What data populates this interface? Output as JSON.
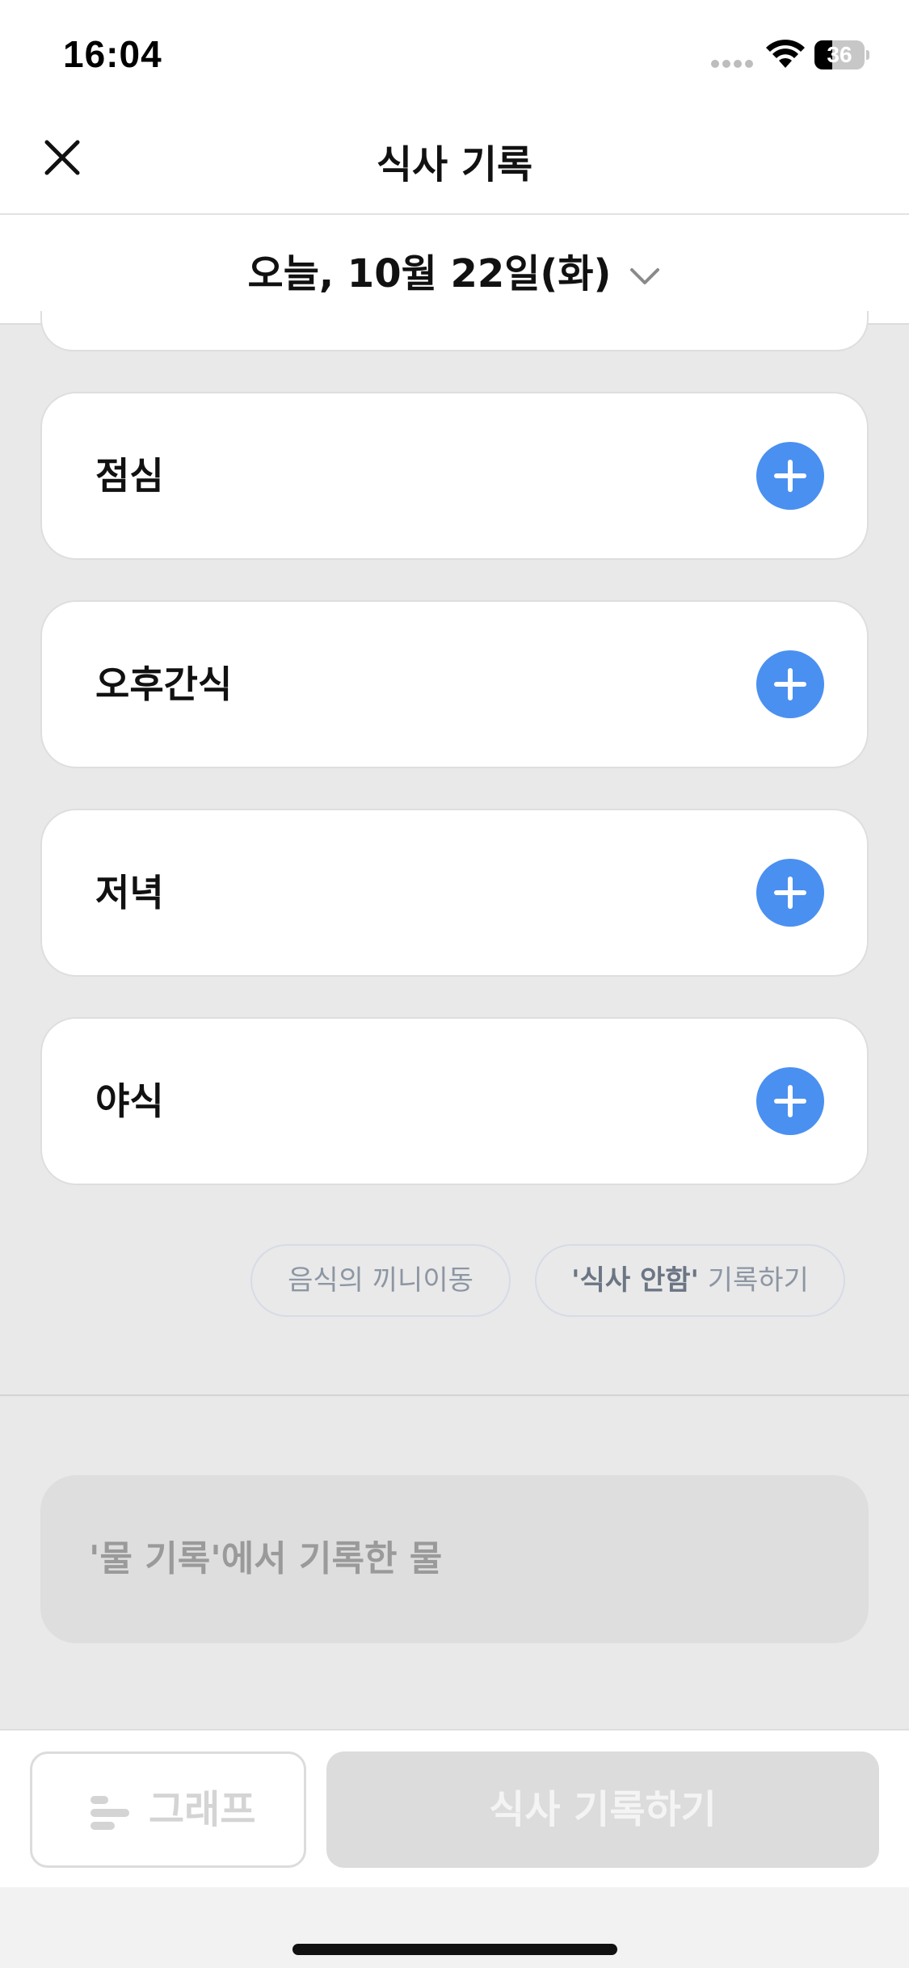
{
  "status_bar": {
    "time": "16:04",
    "battery": "36",
    "battery_level": 0.36
  },
  "header": {
    "title": "식사 기록",
    "close_icon": "close-icon"
  },
  "date_selector": {
    "label": "오늘, 10월 22일(화)",
    "icon": "chevron-down-icon"
  },
  "meals": [
    {
      "label": "점심",
      "icon": "plus-icon"
    },
    {
      "label": "오후간식",
      "icon": "plus-icon"
    },
    {
      "label": "저녁",
      "icon": "plus-icon"
    },
    {
      "label": "야식",
      "icon": "plus-icon"
    }
  ],
  "actions": {
    "food_move": "음식의 끼니이동",
    "no_meal_bold": "'식사 안함'",
    "no_meal_rest": " 기록하기"
  },
  "water": {
    "text": "'물 기록'에서 기록한 물"
  },
  "bottom": {
    "graph_label": "그래프",
    "graph_icon": "bar-chart-icon",
    "submit_label": "식사 기록하기"
  },
  "colors": {
    "accent": "#4a90f0",
    "background": "#e9e9e9",
    "card": "#ffffff",
    "disabled": "#dcdcdc"
  }
}
